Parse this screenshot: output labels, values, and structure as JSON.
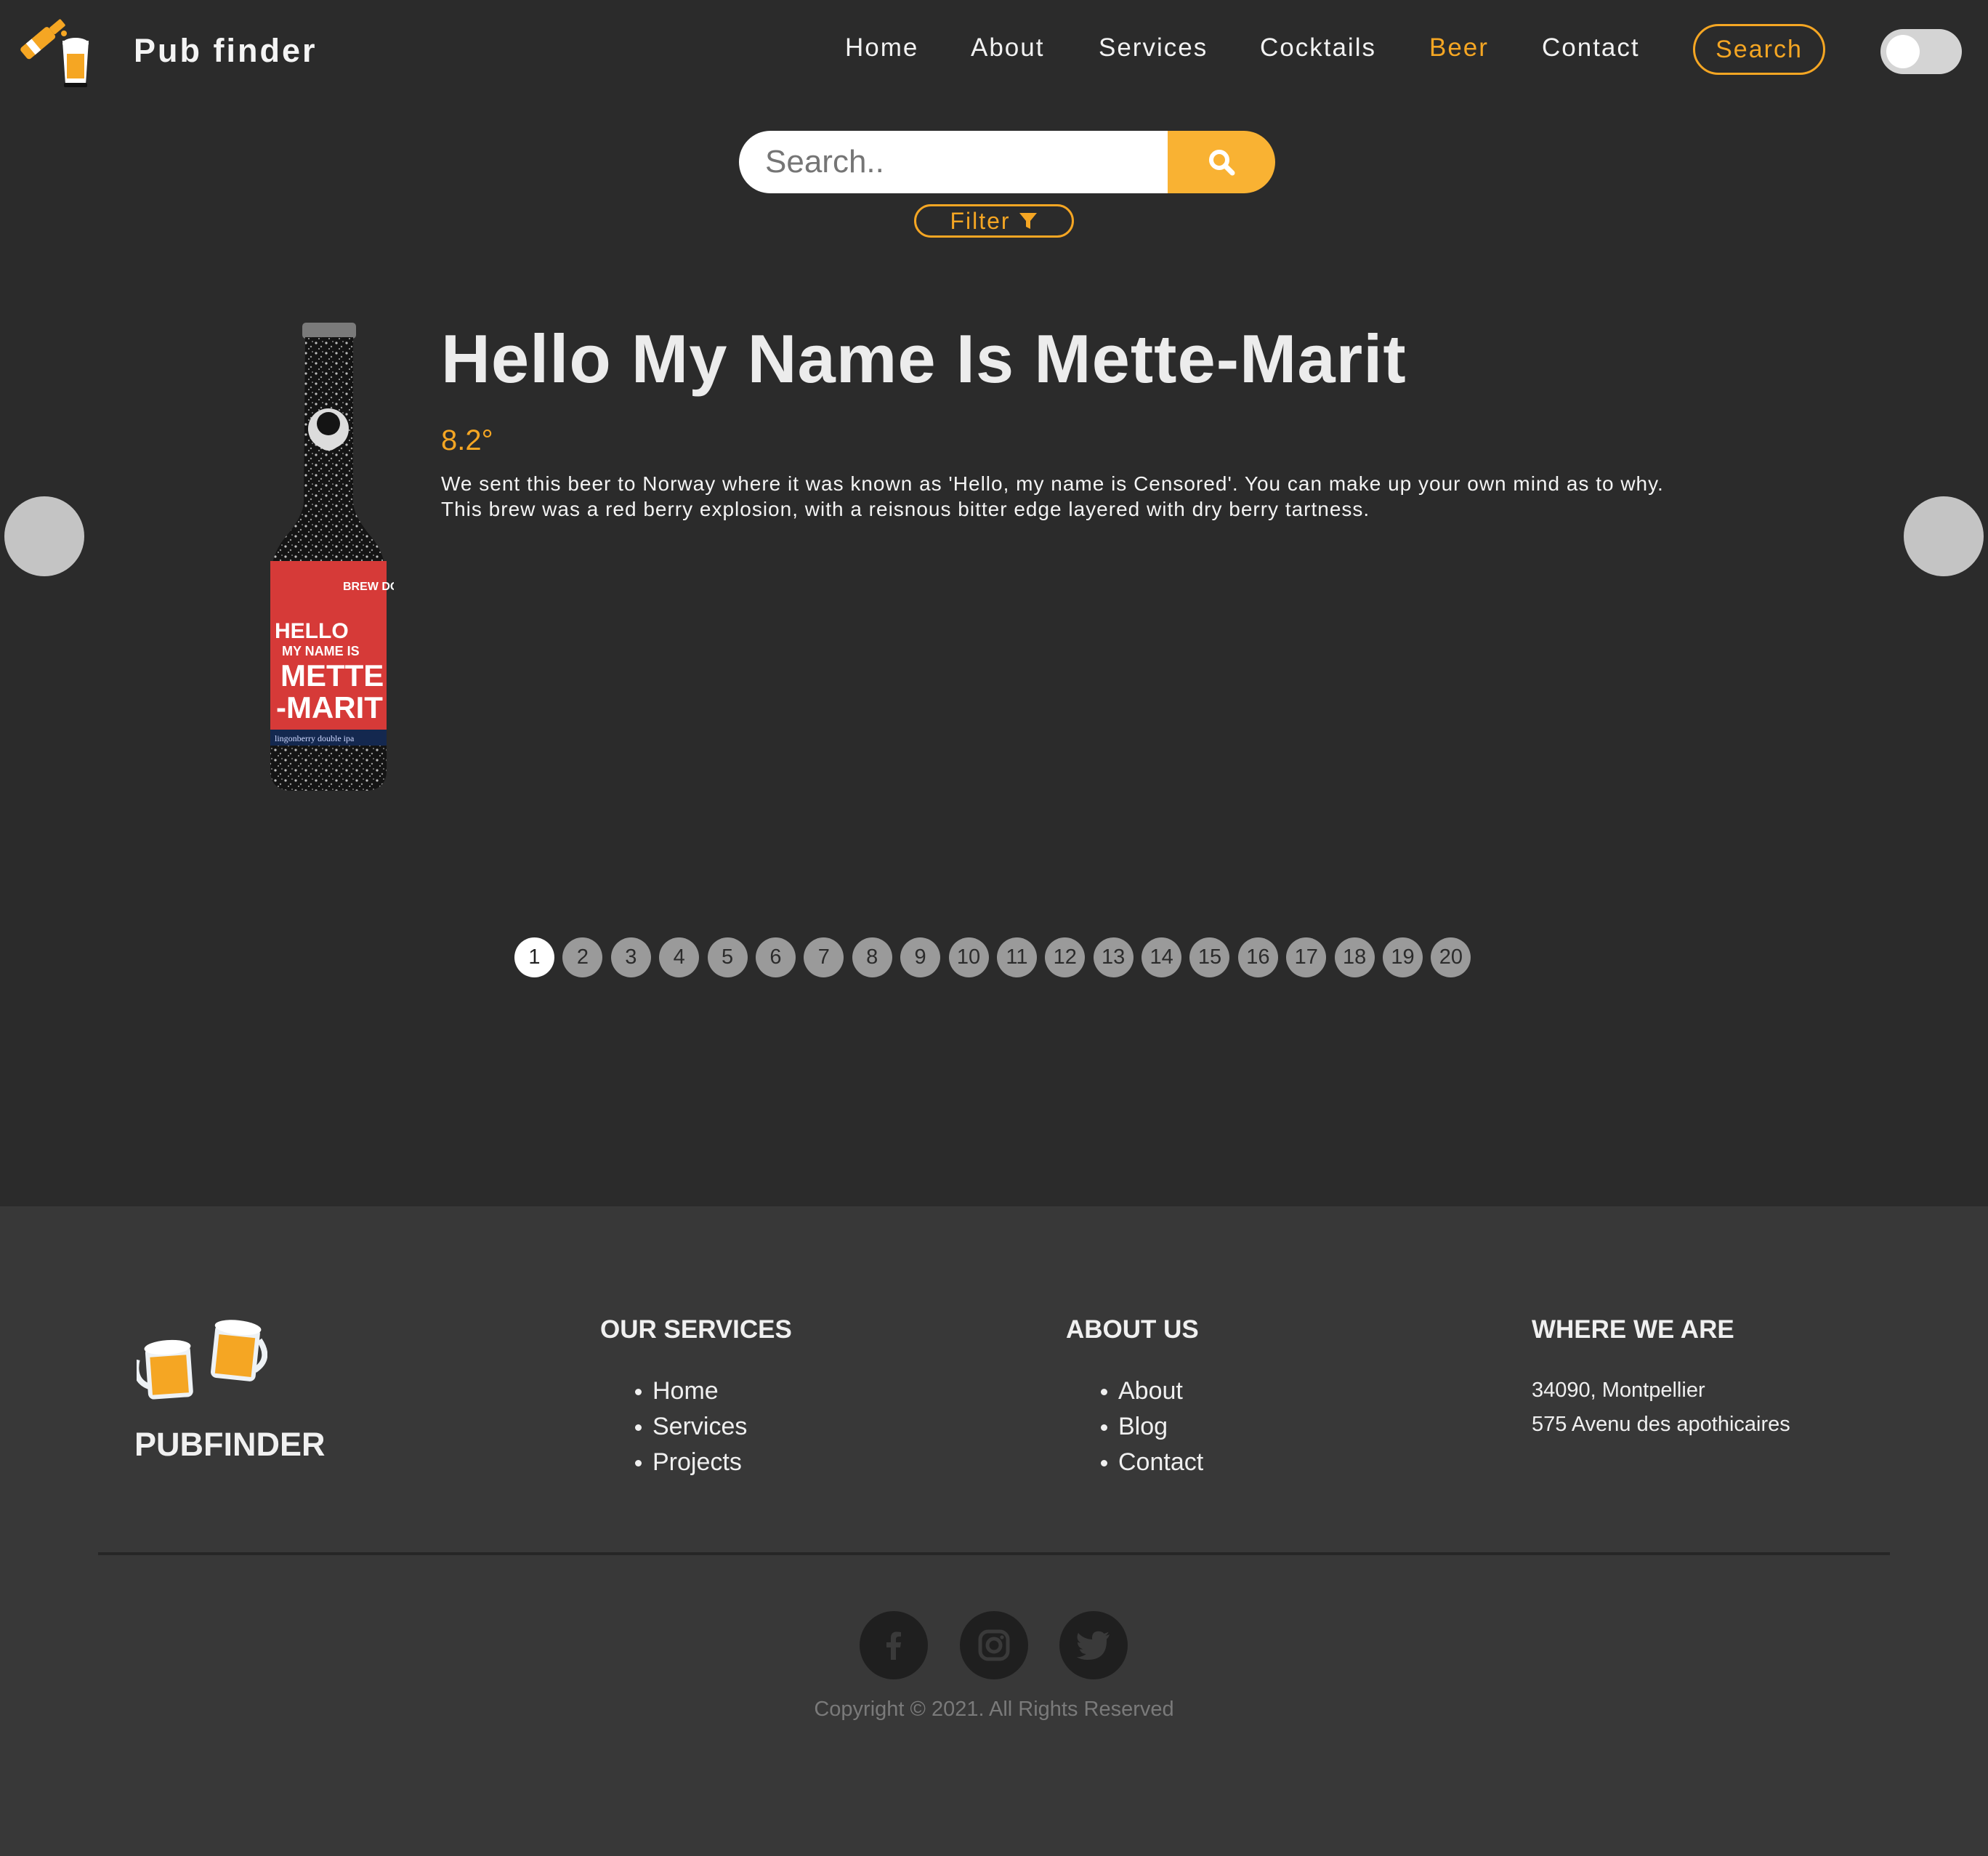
{
  "navbar": {
    "brand": "Pub finder",
    "links": [
      {
        "label": "Home"
      },
      {
        "label": "About"
      },
      {
        "label": "Services"
      },
      {
        "label": "Cocktails"
      },
      {
        "label": "Beer",
        "active": true
      },
      {
        "label": "Contact"
      }
    ],
    "search_button": "Search",
    "theme_toggle_on": false
  },
  "search": {
    "placeholder": "Search..",
    "filter_label": "Filter"
  },
  "beer": {
    "name": "Hello My Name Is Mette-Marit",
    "abv": "8.2°",
    "description": "We sent this beer to Norway where it was known as 'Hello, my name is Censored'. You can make up your own mind as to why. This brew was a red berry explosion, with a reisnous bitter edge layered with dry berry tartness.",
    "bottle_label": [
      "HELLO",
      "MY NAME IS",
      "METTE",
      "-MARIT"
    ],
    "bottle_sublabel": "lingonberry double ipa",
    "bottle_brand": "BREW DOG"
  },
  "pagination": {
    "pages": [
      "1",
      "2",
      "3",
      "4",
      "5",
      "6",
      "7",
      "8",
      "9",
      "10",
      "11",
      "12",
      "13",
      "14",
      "15",
      "16",
      "17",
      "18",
      "19",
      "20"
    ],
    "current": "1"
  },
  "footer": {
    "brand": "PUBFINDER",
    "columns": [
      {
        "title": "OUR SERVICES",
        "items": [
          "Home",
          "Services",
          "Projects"
        ]
      },
      {
        "title": "ABOUT US",
        "items": [
          "About",
          "Blog",
          "Contact"
        ]
      }
    ],
    "where": {
      "title": "WHERE WE ARE",
      "lines": [
        "34090, Montpellier",
        "575 Avenu des apothicaires"
      ]
    },
    "social": [
      "facebook-icon",
      "instagram-icon",
      "twitter-icon"
    ],
    "copyright": "Copyright © 2021. All Rights Reserved"
  },
  "colors": {
    "accent": "#f5a623",
    "background": "#2b2b2b",
    "footer_background": "#383838"
  }
}
